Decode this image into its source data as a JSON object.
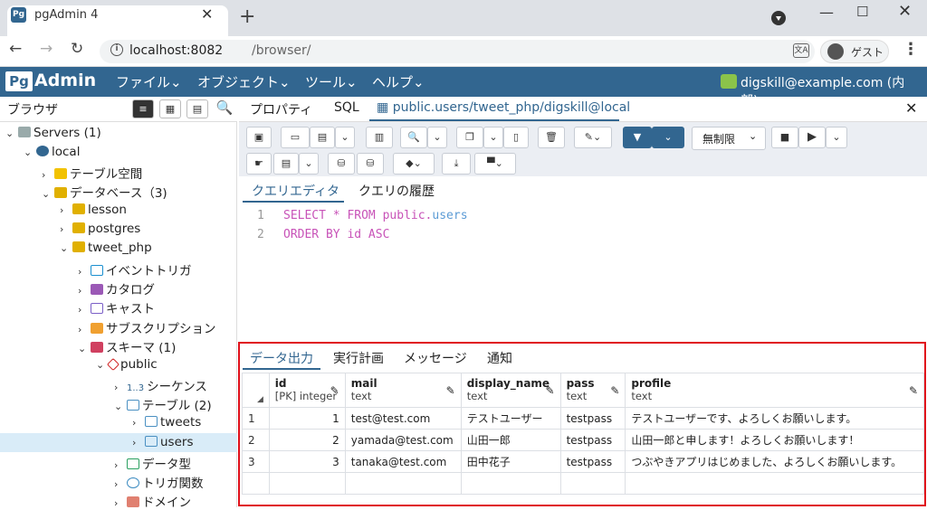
{
  "browser": {
    "tab_title": "pgAdmin 4",
    "tab_logo": "Pg",
    "url_host": "localhost:8082",
    "url_path": "/browser/",
    "guest": "ゲスト",
    "translate": "文A"
  },
  "header": {
    "logo_pg": "Pg",
    "logo_admin": "Admin",
    "menus": [
      "ファイル⌄",
      "オブジェクト⌄",
      "ツール⌄",
      "ヘルプ⌄"
    ],
    "user": "digskill@example.com (内部)⌄"
  },
  "browser_panel": {
    "title": "ブラウザ"
  },
  "tree": [
    {
      "label": "Servers (1)",
      "chev": "⌄"
    },
    {
      "label": "local",
      "chev": "⌄"
    },
    {
      "label": "テーブル空間",
      "chev": "›"
    },
    {
      "label": "データベース（3)",
      "chev": "⌄"
    },
    {
      "label": "lesson",
      "chev": "›"
    },
    {
      "label": "postgres",
      "chev": "›"
    },
    {
      "label": "tweet_php",
      "chev": "⌄"
    },
    {
      "label": "イベントトリガ",
      "chev": "›"
    },
    {
      "label": "カタログ",
      "chev": "›"
    },
    {
      "label": "キャスト",
      "chev": "›"
    },
    {
      "label": "サブスクリプション",
      "chev": "›"
    },
    {
      "label": "スキーマ (1)",
      "chev": "⌄"
    },
    {
      "label": "public",
      "chev": "⌄"
    },
    {
      "label": "シーケンス",
      "chev": "›",
      "prefix": "1..3"
    },
    {
      "label": "テーブル (2)",
      "chev": "⌄"
    },
    {
      "label": "tweets",
      "chev": "›"
    },
    {
      "label": "users",
      "chev": "›"
    },
    {
      "label": "データ型",
      "chev": "›"
    },
    {
      "label": "トリガ関数",
      "chev": "›"
    },
    {
      "label": "ドメイン",
      "chev": "›"
    }
  ],
  "right_tabs": {
    "properties": "プロパティ",
    "sql": "SQL",
    "query": "public.users/tweet_php/digskill@local"
  },
  "toolbar": {
    "limit": "無制限"
  },
  "editor_tabs": {
    "query_editor": "クエリエディタ",
    "history": "クエリの履歴"
  },
  "editor": {
    "line1": "1",
    "line2": "2",
    "kw_select": "SELECT",
    "star": " * ",
    "kw_from": "FROM",
    "schema": " public.",
    "table": "users",
    "kw_order": "ORDER BY id ASC"
  },
  "output_tabs": {
    "data_output": "データ出力",
    "explain": "実行計画",
    "messages": "メッセージ",
    "notifications": "通知"
  },
  "grid": {
    "columns": [
      {
        "name": "id",
        "type": "[PK] integer"
      },
      {
        "name": "mail",
        "type": "text"
      },
      {
        "name": "display_name",
        "type": "text"
      },
      {
        "name": "pass",
        "type": "text"
      },
      {
        "name": "profile",
        "type": "text"
      }
    ],
    "rows": [
      {
        "rn": "1",
        "id": "1",
        "mail": "test@test.com",
        "display_name": "テストユーザー",
        "pass": "testpass",
        "profile": "テストユーザーです、よろしくお願いします。"
      },
      {
        "rn": "2",
        "id": "2",
        "mail": "yamada@test.com",
        "display_name": "山田一郎",
        "pass": "testpass",
        "profile": "山田一郎と申します！よろしくお願いします！"
      },
      {
        "rn": "3",
        "id": "3",
        "mail": "tanaka@test.com",
        "display_name": "田中花子",
        "pass": "testpass",
        "profile": "つぶやきアプリはじめました、よろしくお願いします。"
      }
    ]
  },
  "colors": {
    "brand": "#326690",
    "highlight": "#e0101a",
    "selected": "#d9ecf8"
  }
}
